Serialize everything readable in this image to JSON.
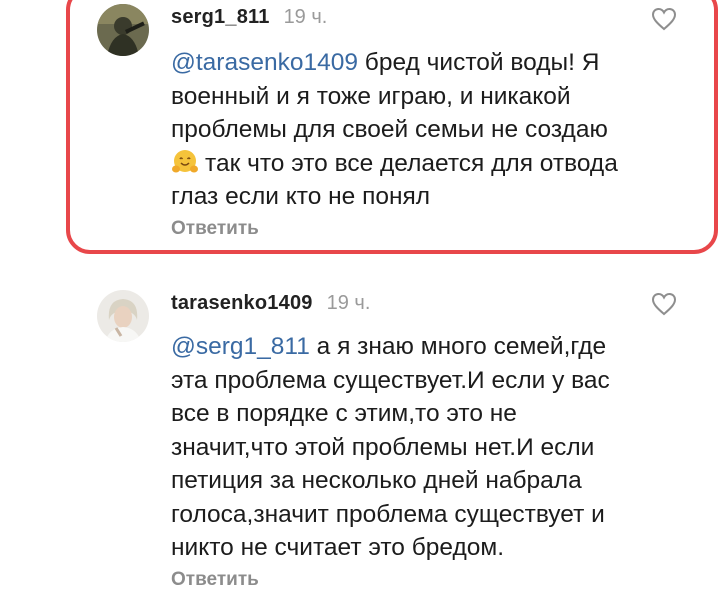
{
  "comments": [
    {
      "username": "serg1_811",
      "time": "19 ч.",
      "mention": "@tarasenko1409",
      "text_first": "бред чистой воды! Я",
      "lines": [
        "военный и я тоже играю, и никакой",
        "проблемы для своей семьи не создаю"
      ],
      "emoji_line": "так что это все делается для отвода",
      "last_line": "глаз если кто не понял",
      "reply": "Ответить",
      "avatar_icon": "soldier-avatar",
      "like_icon": "heart-outline-icon",
      "highlight_color": "#e8474a"
    },
    {
      "username": "tarasenko1409",
      "time": "19 ч.",
      "mention": "@serg1_811",
      "text_first": "а я знаю много семей,где",
      "lines": [
        "эта проблема существует.И если у вас",
        "все в порядке с этим,то это не",
        "значит,что этой проблемы нет.И если",
        "петиция за несколько дней набрала",
        "голоса,значит проблема существует и",
        "никто не считает это бредом."
      ],
      "reply": "Ответить",
      "avatar_icon": "woman-avatar",
      "like_icon": "heart-outline-icon"
    }
  ],
  "colors": {
    "mention": "#3a6aa3",
    "muted": "#9a9a9a",
    "highlight": "#e8474a"
  }
}
